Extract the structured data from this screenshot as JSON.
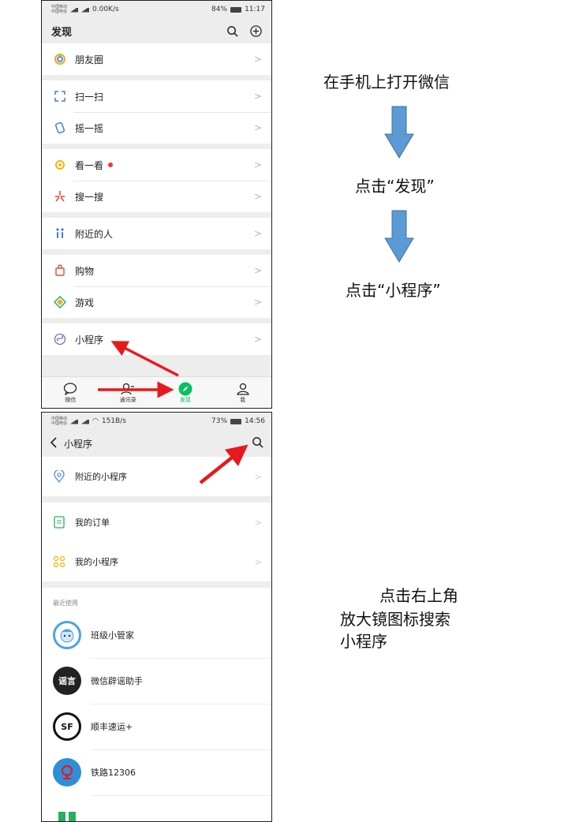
{
  "phone1": {
    "status": {
      "carrier1": "中国移动",
      "carrier2": "中国电信",
      "speed": "0.00K/s",
      "battery": "84%",
      "time": "11:17"
    },
    "title": "发现",
    "groups": [
      [
        {
          "label": "朋友圈",
          "icon": "moments-icon"
        }
      ],
      [
        {
          "label": "扫一扫",
          "icon": "scan-icon"
        },
        {
          "label": "摇一摇",
          "icon": "shake-icon"
        }
      ],
      [
        {
          "label": "看一看",
          "icon": "top-stories-icon",
          "dot": true
        },
        {
          "label": "搜一搜",
          "icon": "search-feature-icon"
        }
      ],
      [
        {
          "label": "附近的人",
          "icon": "people-nearby-icon"
        }
      ],
      [
        {
          "label": "购物",
          "icon": "shopping-icon"
        },
        {
          "label": "游戏",
          "icon": "games-icon"
        }
      ],
      [
        {
          "label": "小程序",
          "icon": "mini-programs-icon"
        }
      ]
    ],
    "tabs": [
      {
        "label": "微信",
        "icon": "chat-icon"
      },
      {
        "label": "通讯录",
        "icon": "contacts-icon"
      },
      {
        "label": "发现",
        "icon": "discover-icon",
        "active": true
      },
      {
        "label": "我",
        "icon": "me-icon"
      }
    ]
  },
  "phone2": {
    "status": {
      "carrier1": "中国移动",
      "carrier2": "中国电信",
      "speed": "151B/s",
      "battery": "73%",
      "time": "14:56"
    },
    "title": "小程序",
    "nearby": "附近的小程序",
    "orders": "我的订单",
    "mine": "我的小程序",
    "recent_label": "最近使用",
    "apps": [
      {
        "name": "班级小管家",
        "color": "#4aa3e8"
      },
      {
        "name": "微信辟谣助手",
        "color": "#222222",
        "badge": "谣言"
      },
      {
        "name": "顺丰速运+",
        "color": "#ffffff",
        "badge": "SF"
      },
      {
        "name": "铁路12306",
        "color": "#2e8fd8"
      }
    ]
  },
  "flow": {
    "step1": "在手机上打开微信",
    "step2": "点击“发现”",
    "step3": "点击“小程序”",
    "step4_line1": "点击右上角",
    "step4_line2": "放大镜图标搜索",
    "step4_line3": "小程序"
  },
  "colors": {
    "wechat_green": "#07c160",
    "arrow_blue": "#5b9bd5",
    "annotation_red": "#e8191c"
  }
}
